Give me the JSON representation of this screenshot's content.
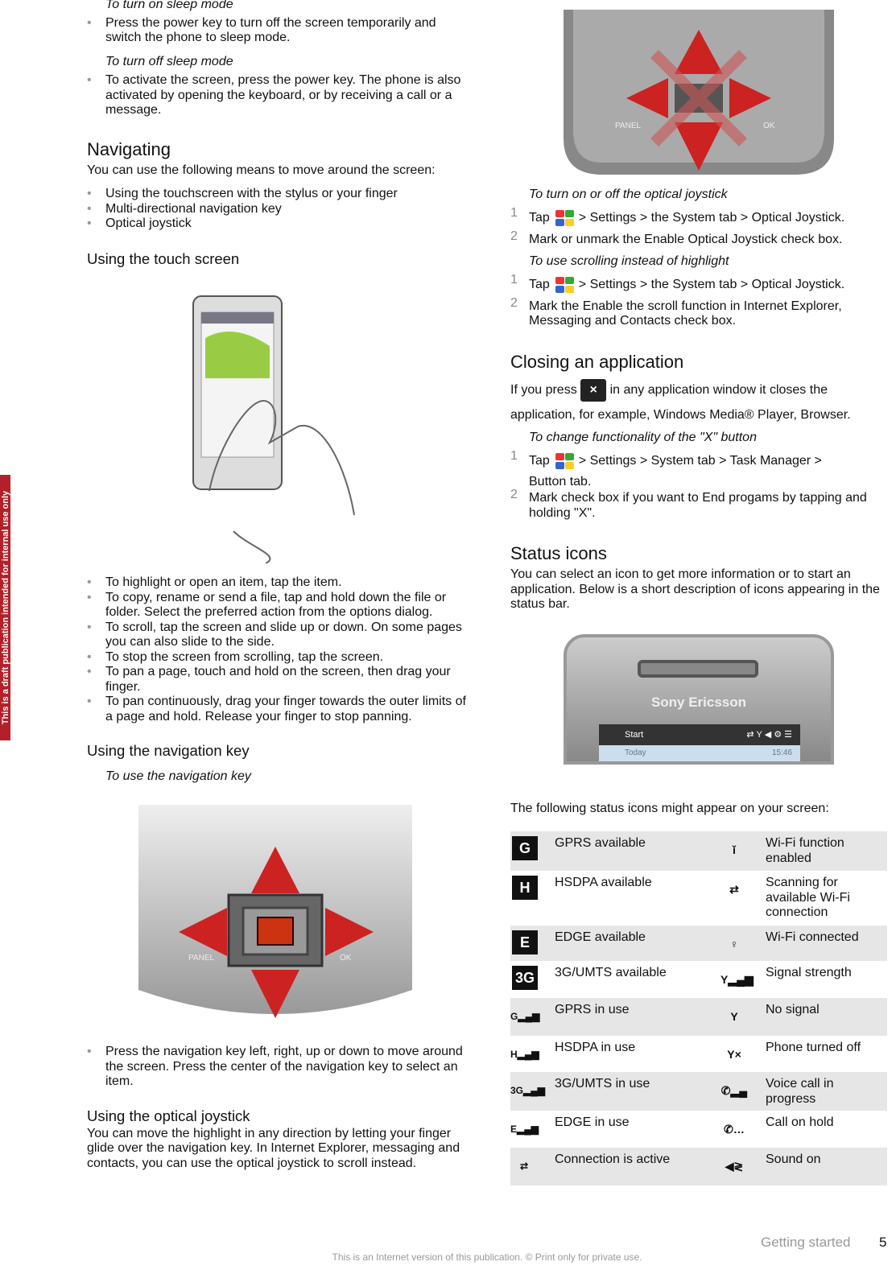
{
  "stamp": "This is a draft publication intended for internal use only",
  "left": {
    "sleep_on_title": "To turn on sleep mode",
    "sleep_on_bullet": "Press the power key to turn off the screen temporarily and switch the phone to sleep mode.",
    "sleep_off_title": "To turn off sleep mode",
    "sleep_off_bullet": "To activate the screen, press the power key. The phone is also activated by opening the keyboard, or by receiving a call or a message.",
    "navigating_heading": "Navigating",
    "navigating_intro": "You can use the following means to move around the screen:",
    "navigating_bullets": [
      "Using the touchscreen with the stylus or your finger",
      "Multi-directional navigation key",
      "Optical joystick"
    ],
    "touch_heading": "Using the touch screen",
    "touch_bullets": [
      "To highlight or open an item, tap the item.",
      "To copy, rename or send a file, tap and hold down the file or folder. Select the preferred action from the options dialog.",
      "To scroll, tap the screen and slide up or down. On some pages you can also slide to the side.",
      "To stop the screen from scrolling, tap the screen.",
      "To pan a page, touch and hold on the screen, then drag your finger.",
      "To pan continuously, drag your finger towards the outer limits of a page and hold. Release your finger to stop panning."
    ],
    "navkey_heading": "Using the navigation key",
    "navkey_title": "To use the navigation key",
    "navkey_image_labels": [
      "PANEL",
      "OK"
    ],
    "navkey_bullet": "Press the navigation key left, right, up or down to move around the screen. Press the center of the navigation key to select an item.",
    "joystick_heading": "Using the optical joystick",
    "joystick_text": "You can move the highlight in any direction by letting your finger glide over the navigation key. In Internet Explorer, messaging and contacts, you can use the optical joystick to scroll instead."
  },
  "right": {
    "joy_image_labels": [
      "PANEL",
      "OK"
    ],
    "joy_toggle_title": "To turn on or off the optical joystick",
    "joy_toggle_steps": [
      {
        "n": "1",
        "pre": "Tap",
        "post": "> Settings > the System tab > Optical Joystick."
      },
      {
        "n": "2",
        "text": "Mark or unmark the Enable Optical Joystick check box."
      }
    ],
    "scroll_title": "To use scrolling instead of highlight",
    "scroll_steps": [
      {
        "n": "1",
        "pre": "Tap",
        "post": "> Settings > the System tab > Optical Joystick."
      },
      {
        "n": "2",
        "text": "Mark the Enable the scroll function in Internet Explorer, Messaging and Contacts check box."
      }
    ],
    "closing_heading": "Closing an application",
    "closing_pre": "If you press",
    "closing_x": "×",
    "closing_post": "in any application window it closes the",
    "closing_line2": "application, for example, Windows Media® Player, Browser.",
    "x_title": "To change functionality of the \"X\" button",
    "x_steps": [
      {
        "n": "1",
        "pre": "Tap",
        "post": "> Settings > System tab > Task Manager >",
        "line2": "Button tab."
      },
      {
        "n": "2",
        "text": "Mark check box if you want to End progams by tapping and holding \"X\"."
      }
    ],
    "status_heading": "Status icons",
    "status_intro": "You can select an icon to get more information or to start an application. Below is a short description of icons appearing in the status bar.",
    "phone_brand": "Sony Ericsson",
    "phone_start": "Start",
    "phone_today": "Today",
    "phone_time": "15:46",
    "table_intro": "The following status icons might appear on your screen:",
    "rows": [
      {
        "icon1": "G",
        "label1": "GPRS available",
        "icon2": "wifi-enabled",
        "glyph2": "ǐ",
        "label2": "Wi-Fi function enabled"
      },
      {
        "icon1": "H",
        "label1": "HSDPA available",
        "icon2": "wifi-scanning",
        "glyph2": "⇄",
        "label2": "Scanning for available Wi-Fi connection"
      },
      {
        "icon1": "E",
        "label1": "EDGE available",
        "icon2": "wifi-connected",
        "glyph2": "♀",
        "label2": "Wi-Fi connected"
      },
      {
        "icon1": "3G",
        "label1": "3G/UMTS available",
        "icon2": "signal-strength",
        "glyph2": "Y▂▄▆",
        "label2": "Signal strength"
      },
      {
        "icon1": "G▂▄▆",
        "label1": "GPRS in use",
        "icon2": "no-signal",
        "glyph2": "Y",
        "label2": "No signal"
      },
      {
        "icon1": "H▂▄▆",
        "label1": "HSDPA in use",
        "icon2": "phone-off",
        "glyph2": "Y×",
        "label2": "Phone turned off"
      },
      {
        "icon1": "3G▂▄▆",
        "label1": "3G/UMTS in use",
        "icon2": "voice-call",
        "glyph2": "✆▂▄",
        "label2": "Voice call in progress"
      },
      {
        "icon1": "E▂▄▆",
        "label1": "EDGE in use",
        "icon2": "call-hold",
        "glyph2": "✆…",
        "label2": "Call on hold"
      },
      {
        "icon1": "⇄",
        "label1": "Connection is active",
        "icon2": "sound-on",
        "glyph2": "◀≷",
        "label2": "Sound on"
      }
    ]
  },
  "footer": {
    "section": "Getting started",
    "page": "5",
    "notice": "This is an Internet version of this publication. © Print only for private use."
  }
}
